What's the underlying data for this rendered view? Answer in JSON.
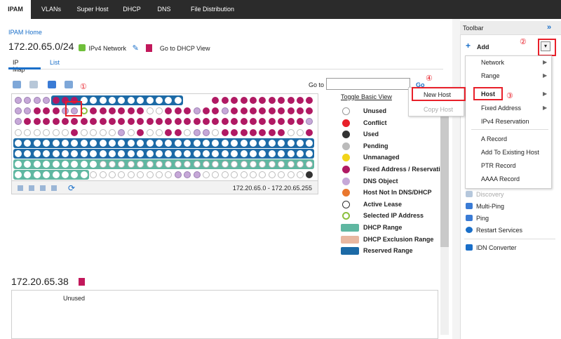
{
  "nav": {
    "tabs": [
      "IPAM",
      "VLANs",
      "Super Host",
      "DHCP",
      "DNS",
      "File Distribution"
    ],
    "active": "IPAM"
  },
  "breadcrumb": "IPAM Home",
  "network": {
    "address": "172.20.65.0/24",
    "type_label": "IPv4 Network",
    "dhcp_link": "Go to DHCP View"
  },
  "subtabs": [
    "IP Map",
    "List"
  ],
  "goto": {
    "label": "Go to",
    "value": "",
    "button": "Go"
  },
  "ipmap": {
    "range_label": "172.20.65.0 - 172.20.65.255"
  },
  "legend": {
    "toggle": "Toggle Basic View",
    "items": [
      {
        "label": "Unused",
        "color": "#ffffff"
      },
      {
        "label": "Conflict",
        "color": "#e8202a"
      },
      {
        "label": "Used",
        "color": "#333333"
      },
      {
        "label": "Pending",
        "color": "#bbbbbb"
      },
      {
        "label": "Unmanaged",
        "color": "#f2d41a"
      },
      {
        "label": "Fixed Address / Reservation",
        "color": "#b01963"
      },
      {
        "label": "DNS Object",
        "color": "#c6a8d8"
      },
      {
        "label": "Host Not In DNS/DHCP",
        "color": "#e9772e"
      },
      {
        "label": "Active Lease",
        "color": "#ffffff"
      },
      {
        "label": "Selected IP Address",
        "color": "#8bbf3d"
      },
      {
        "label": "DHCP Range",
        "color": "#5fb7a1"
      },
      {
        "label": "DHCP Exclusion Range",
        "color": "#e8b7a0"
      },
      {
        "label": "Reserved Range",
        "color": "#1c6aa6"
      }
    ]
  },
  "detail": {
    "address": "172.20.65.38",
    "status": "Unused"
  },
  "toolbar": {
    "title": "Toolbar",
    "add_label": "Add",
    "menu": [
      "Network",
      "Range",
      "Host",
      "Fixed Address",
      "IPv4 Reservation",
      "A Record",
      "Add To Existing Host",
      "PTR Record",
      "AAAA Record"
    ],
    "submenu": [
      "New Host",
      "Copy Host"
    ],
    "items": [
      "Discovery",
      "Multi-Ping",
      "Ping",
      "Restart Services",
      "IDN Converter"
    ]
  },
  "annotations": [
    "①",
    "②",
    "③",
    "④"
  ],
  "colors": {
    "accent": "#1a6fc9",
    "fixed": "#b01963",
    "dns": "#c6a8d8",
    "reserved": "#1c6aa6",
    "dhcp": "#5fb7a1",
    "highlight": "#e8202a",
    "topnav": "#2b2b2b"
  }
}
